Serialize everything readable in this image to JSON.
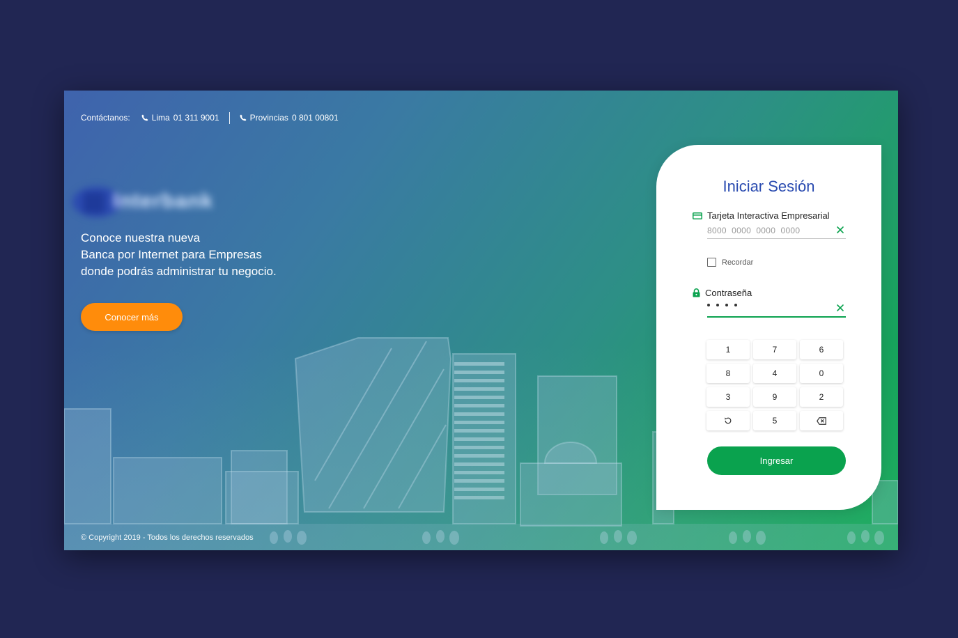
{
  "header": {
    "contact_label": "Contáctanos:",
    "phone_lima_prefix": "Lima",
    "phone_lima_number": "01 311 9001",
    "phone_provincias_prefix": "Provincias",
    "phone_provincias_number": "0 801 00801"
  },
  "hero": {
    "logo_text": "Interbank",
    "headline_line1": "Conoce nuestra nueva",
    "headline_line2": "Banca por Internet para Empresas",
    "headline_line3": "donde podrás administrar tu negocio.",
    "cta_label": "Conocer más"
  },
  "footer": {
    "copyright": "© Copyright 2019 - Todos los derechos reservados"
  },
  "login": {
    "title": "Iniciar Sesión",
    "card_label": "Tarjeta Interactiva Empresarial",
    "card_value": "8000  0000  0000  0000",
    "remember_label": "Recordar",
    "password_label": "Contraseña",
    "password_masked_length": 4,
    "keypad": [
      "1",
      "7",
      "6",
      "8",
      "4",
      "0",
      "3",
      "9",
      "2",
      "reset-icon",
      "5",
      "backspace-icon"
    ],
    "submit_label": "Ingresar"
  },
  "colors": {
    "page_bg": "#212653",
    "accent_orange": "#ff8c0b",
    "accent_green": "#0aa24e",
    "title_blue": "#2a4bb0"
  }
}
